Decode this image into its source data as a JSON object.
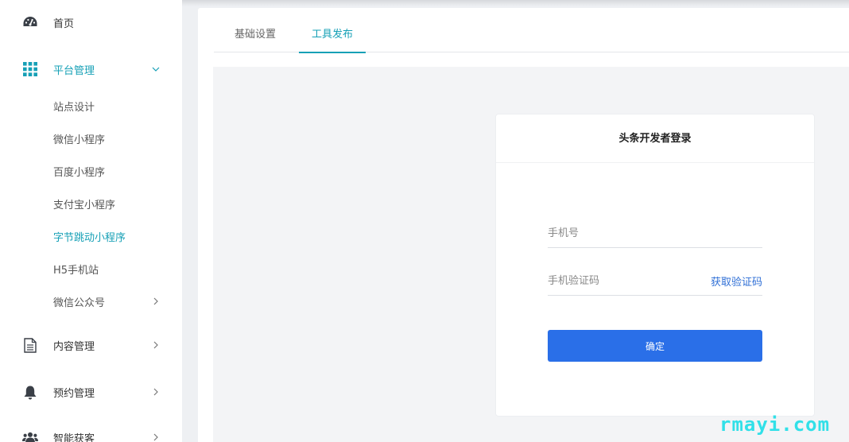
{
  "sidebar": {
    "items": [
      {
        "label": "首页",
        "icon": "dashboard-icon"
      },
      {
        "label": "平台管理",
        "icon": "grid-icon",
        "expanded": true
      },
      {
        "label": "内容管理",
        "icon": "document-icon"
      },
      {
        "label": "预约管理",
        "icon": "bell-icon"
      },
      {
        "label": "智能获客",
        "icon": "users-icon"
      }
    ],
    "sub_items": [
      {
        "label": "站点设计"
      },
      {
        "label": "微信小程序"
      },
      {
        "label": "百度小程序"
      },
      {
        "label": "支付宝小程序"
      },
      {
        "label": "字节跳动小程序",
        "active": true
      },
      {
        "label": "H5手机站"
      },
      {
        "label": "微信公众号",
        "has_children": true
      }
    ]
  },
  "tabs": [
    {
      "label": "基础设置"
    },
    {
      "label": "工具发布",
      "active": true
    }
  ],
  "login": {
    "title": "头条开发者登录",
    "phone_placeholder": "手机号",
    "code_placeholder": "手机验证码",
    "get_code_label": "获取验证码",
    "confirm_label": "确定"
  },
  "watermark": "rmayi.com",
  "colors": {
    "accent": "#16a0b6",
    "primary_button": "#2a6fe8",
    "link": "#2f6fd6"
  }
}
